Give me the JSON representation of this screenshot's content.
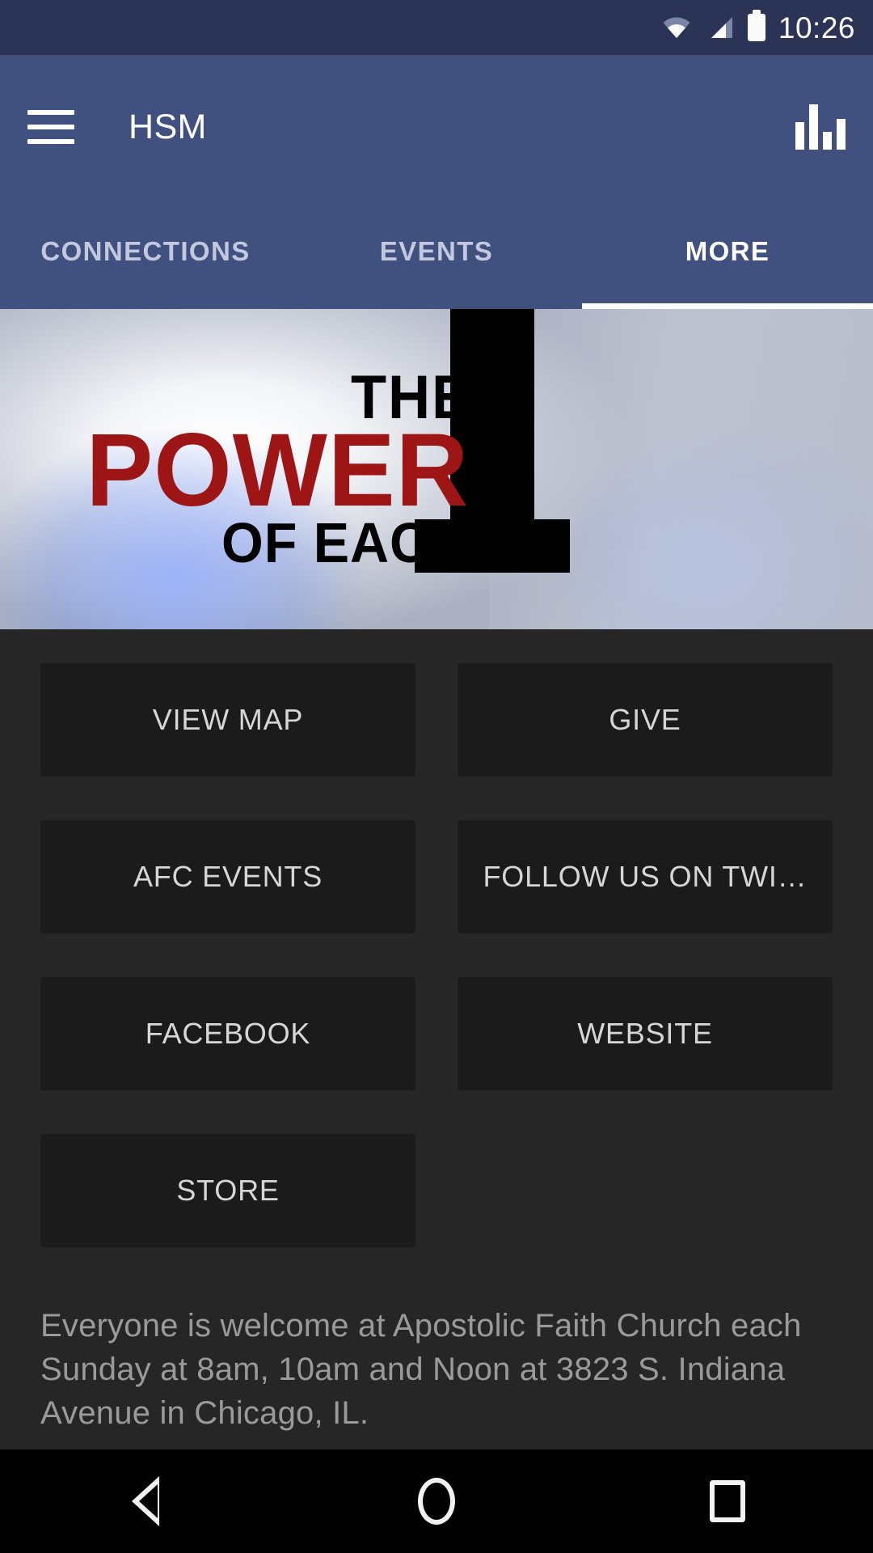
{
  "status_bar": {
    "time": "10:26",
    "wifi_icon": "wifi-icon",
    "signal_icon": "signal-icon",
    "battery_icon": "battery-full-icon"
  },
  "app_bar": {
    "menu_icon": "hamburger-menu-icon",
    "title": "HSM",
    "action_icon": "bar-chart-icon"
  },
  "tabs": [
    {
      "label": "CONNECTIONS",
      "active": false
    },
    {
      "label": "EVENTS",
      "active": false
    },
    {
      "label": "MORE",
      "active": true
    }
  ],
  "banner": {
    "line1": "THE",
    "line2": "POWER",
    "line3": "OF EACH",
    "numeral": "1",
    "accent_color": "#9e1515"
  },
  "tiles": [
    {
      "label": "VIEW MAP"
    },
    {
      "label": "GIVE"
    },
    {
      "label": "AFC EVENTS"
    },
    {
      "label": "FOLLOW US ON TWI…"
    },
    {
      "label": "FACEBOOK"
    },
    {
      "label": "WEBSITE"
    },
    {
      "label": "STORE"
    }
  ],
  "description": "Everyone is welcome at Apostolic Faith Church each Sunday at 8am, 10am and Noon at 3823 S. Indiana Avenue in Chicago, IL.",
  "nav_bar": {
    "back_icon": "back-triangle-icon",
    "home_icon": "home-circle-icon",
    "recents_icon": "recents-square-icon"
  },
  "colors": {
    "status_bar": "#2b3356",
    "app_bar": "#41517f",
    "page_background": "#262626",
    "tile_background": "#1b1b1b",
    "tile_text": "#d6d6d6",
    "description_text": "#9a9a9a"
  }
}
